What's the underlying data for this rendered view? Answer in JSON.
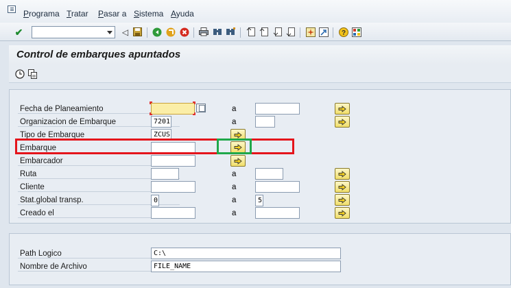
{
  "menu": {
    "items": [
      {
        "mnemonic": "P",
        "rest": "rograma"
      },
      {
        "mnemonic": "T",
        "rest": "ratar"
      },
      {
        "mnemonic": "P",
        "rest": "asar a"
      },
      {
        "mnemonic": "S",
        "rest": "istema"
      },
      {
        "mnemonic": "A",
        "rest": "yuda"
      }
    ]
  },
  "toolbar": {
    "command_field_value": ""
  },
  "title": "Control de embarques apuntados",
  "selection": {
    "fields": [
      {
        "label": "Fecha de Planeamiento",
        "from": "",
        "to": "",
        "has_to": true,
        "has_multi": true
      },
      {
        "label": "Organizacion de Embarque",
        "from": "7201",
        "to": "",
        "has_to": true,
        "has_multi": true
      },
      {
        "label": "Tipo de Embarque",
        "from": "ZCUS",
        "to": null,
        "has_to": false,
        "has_multi": true
      },
      {
        "label": "Embarque",
        "from": "",
        "to": null,
        "has_to": false,
        "has_multi": true
      },
      {
        "label": "Embarcador",
        "from": "",
        "to": null,
        "has_to": false,
        "has_multi": true
      },
      {
        "label": "Ruta",
        "from": "",
        "to": "",
        "has_to": true,
        "has_multi": true
      },
      {
        "label": "Cliente",
        "from": "",
        "to": "",
        "has_to": true,
        "has_multi": true
      },
      {
        "label": "Stat.global transp.",
        "from": "0",
        "to": "5",
        "has_to": true,
        "has_multi": true
      },
      {
        "label": "Creado el",
        "from": "",
        "to": "",
        "has_to": true,
        "has_multi": true
      }
    ],
    "range_label": "a"
  },
  "file": {
    "path_label": "Path Logico",
    "path_value": "C:\\",
    "name_label": "Nombre de Archivo",
    "name_value": "FILE_NAME"
  },
  "colors": {
    "highlight_red": "#e4141b",
    "highlight_green": "#1fa84a"
  }
}
